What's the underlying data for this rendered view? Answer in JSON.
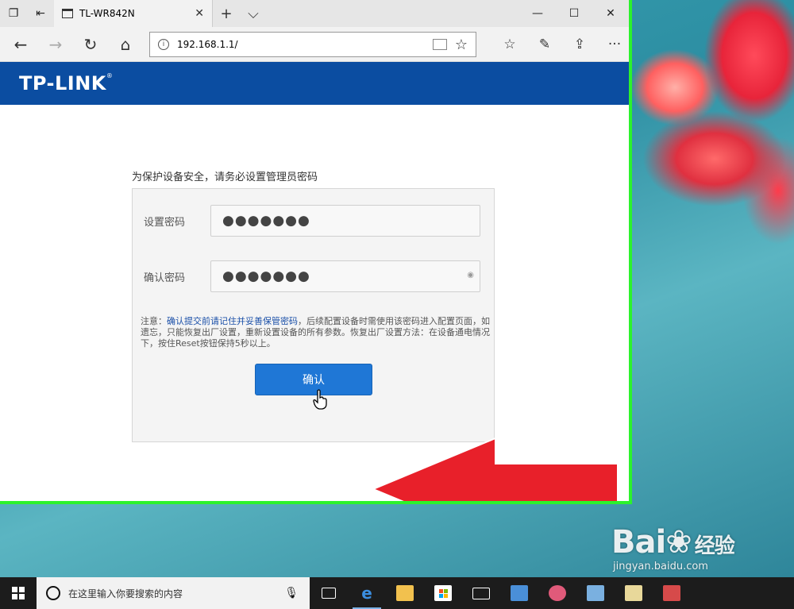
{
  "browser": {
    "tab_title": "TL-WR842N",
    "tab_close": "✕",
    "new_tab": "+",
    "tab_menu": "⌵",
    "url": "192.168.1.1/",
    "window_controls": {
      "minimize": "—",
      "maximize": "☐",
      "close": "✕"
    },
    "nav": {
      "back": "←",
      "forward": "→",
      "refresh": "↻",
      "home": "⌂"
    },
    "toolbar": {
      "favorites": "☆",
      "notes": "✎",
      "share": "⇪",
      "more": "···"
    }
  },
  "page": {
    "logo": "TP-LINK",
    "prompt": "为保护设备安全，请务必设置管理员密码",
    "set_password_label": "设置密码",
    "set_password_value": "●●●●●●●",
    "confirm_password_label": "确认密码",
    "confirm_password_value": "●●●●●●●",
    "note_prefix": "注意：",
    "note_highlight": "确认提交前请记住并妥善保管密码",
    "note_rest": "，后续配置设备时需使用该密码进入配置页面，如遗忘，只能恢复出厂设置，重新设置设备的所有参数。恢复出厂设置方法：在设备通电情况下，按住Reset按钮保持5秒以上。",
    "confirm_button": "确认"
  },
  "taskbar": {
    "search_placeholder": "在这里输入你要搜索的内容"
  },
  "watermark": {
    "brand": "Bai",
    "brand_cn": "经验",
    "site": "jingyan.baidu.com"
  },
  "colors": {
    "banner": "#0b4da1",
    "button": "#1f77d6",
    "window_border": "#2cf22c",
    "arrow": "#e8202a"
  }
}
